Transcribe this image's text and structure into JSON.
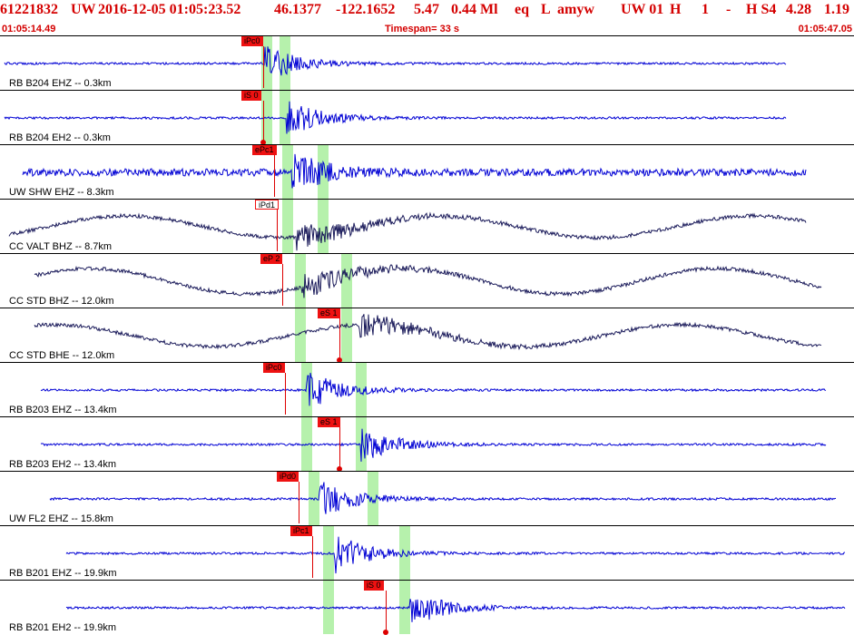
{
  "header": {
    "event_id": "61221832",
    "network": "UW",
    "date_time": "2016-12-05 01:05:23.52",
    "lat": "46.1377",
    "lon": "-122.1652",
    "depth": "5.47",
    "magnitude": "0.44 Ml",
    "event_type": "eq",
    "flag": "L",
    "author": "amyw",
    "region": "UW 01",
    "quality": "H",
    "count": "1",
    "dash": "-",
    "solution": "H S4",
    "rms": "4.28",
    "err": "1.19"
  },
  "time_start": "01:05:14.49",
  "timespan": "Timespan=  33 s",
  "time_end": "01:05:47.05",
  "colors": {
    "trace_blue": "#0000d4",
    "trace_navy": "#1a1a5a",
    "header_red": "#d40000",
    "pick_red": "#ee1111",
    "band_green": "#a9ee9e"
  },
  "panels": [
    {
      "label": "RB B204 EHZ -- 0.3km",
      "color": "blue",
      "pick": "iPc0",
      "style": "fill",
      "amp": 3
    },
    {
      "label": "RB B204 EH2 -- 0.3km",
      "color": "blue",
      "pick": "iS 0",
      "style": "fill",
      "amp": 2
    },
    {
      "label": "UW SHW EHZ -- 8.3km",
      "color": "blue",
      "pick": "ePc1",
      "style": "fill",
      "amp": 10
    },
    {
      "label": "CC VALT BHZ -- 8.7km",
      "color": "navy",
      "pick": "iPd1",
      "style": "outline",
      "amp": 12
    },
    {
      "label": "CC STD BHZ -- 12.0km",
      "color": "navy",
      "pick": "eP 2",
      "style": "fill",
      "amp": 14
    },
    {
      "label": "CC STD BHE -- 12.0km",
      "color": "navy",
      "pick": "eS 1",
      "style": "fill",
      "amp": 12
    },
    {
      "label": "RB B203 EHZ -- 13.4km",
      "color": "blue",
      "pick": "iPc0",
      "style": "fill",
      "amp": 6
    },
    {
      "label": "RB B203 EH2 -- 13.4km",
      "color": "blue",
      "pick": "eS 1",
      "style": "fill",
      "amp": 2
    },
    {
      "label": "UW FL2 EHZ -- 15.8km",
      "color": "blue",
      "pick": "iPd0",
      "style": "fill",
      "amp": 6
    },
    {
      "label": "RB B201 EHZ -- 19.9km",
      "color": "blue",
      "pick": "iPc1",
      "style": "fill",
      "amp": 7
    },
    {
      "label": "RB B201 EH2 -- 19.9km",
      "color": "blue",
      "pick": "iS 0",
      "style": "fill",
      "amp": 5
    }
  ]
}
